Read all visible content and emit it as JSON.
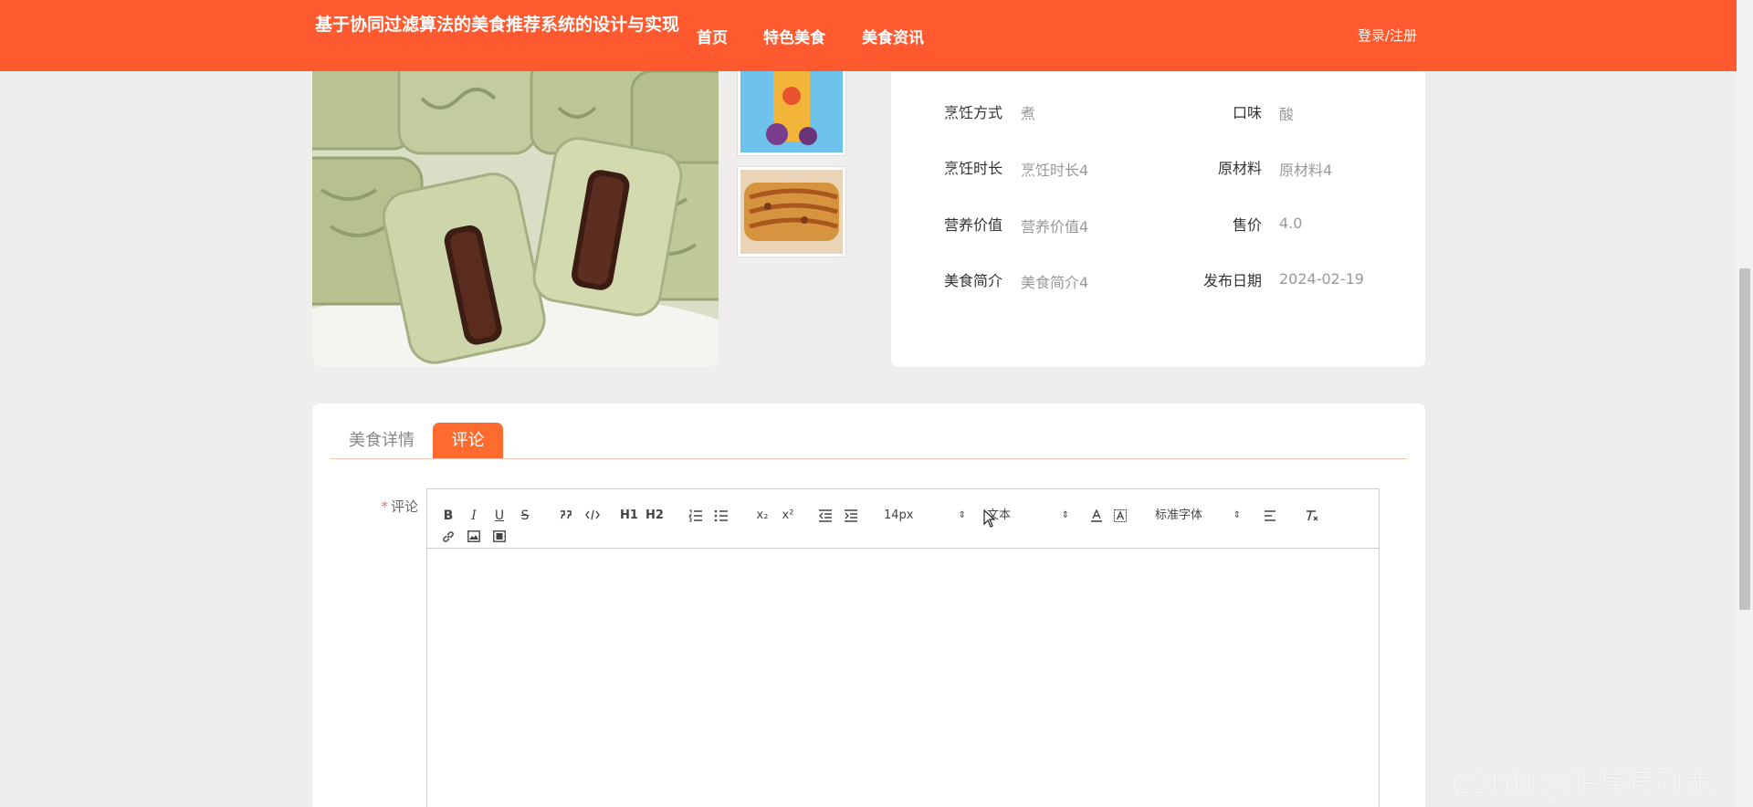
{
  "header": {
    "site_title": "基于协同过滤算法的美食推荐系统的设计与实现",
    "nav": [
      "首页",
      "特色美食",
      "美食资讯"
    ],
    "login": "登录/注册"
  },
  "info": {
    "rows": [
      {
        "label1": "烹饪方式",
        "value1": "煮",
        "label2": "口味",
        "value2": "酸"
      },
      {
        "label1": "烹饪时长",
        "value1": "烹饪时长4",
        "label2": "原材料",
        "value2": "原材料4"
      },
      {
        "label1": "营养价值",
        "value1": "营养价值4",
        "label2": "售价",
        "value2": "4.0"
      },
      {
        "label1": "美食简介",
        "value1": "美食简介4",
        "label2": "发布日期",
        "value2": "2024-02-19"
      }
    ]
  },
  "tabs": [
    "美食详情",
    "评论"
  ],
  "form": {
    "required_mark": "*",
    "comment_label": "评论"
  },
  "editor": {
    "font_size": "14px",
    "header_picker": "文本",
    "font_family": "标准字体",
    "buttons": {
      "bold": "B",
      "italic": "I",
      "underline": "U",
      "strike": "S",
      "h1": "H1",
      "h2": "H2",
      "sub": "x₂",
      "sup": "x²"
    }
  },
  "watermark": "CSDN @程序员阿龙",
  "colors": {
    "accent": "#ff5a2f",
    "tab_active": "#ff6a2f"
  }
}
